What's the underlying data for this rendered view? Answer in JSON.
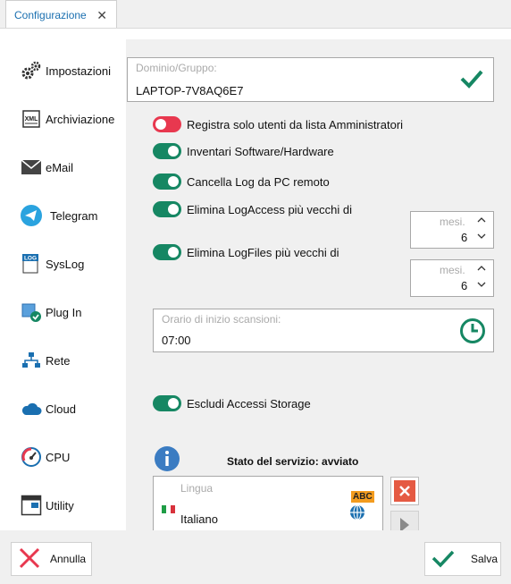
{
  "tab": {
    "title": "Configurazione",
    "close": "✕"
  },
  "sidebar": {
    "items": [
      {
        "label": "Impostazioni"
      },
      {
        "label": "Archiviazione"
      },
      {
        "label": "eMail"
      },
      {
        "label": "Telegram"
      },
      {
        "label": "SysLog"
      },
      {
        "label": "Plug In"
      },
      {
        "label": "Rete"
      },
      {
        "label": "Cloud"
      },
      {
        "label": "CPU"
      },
      {
        "label": "Utility"
      }
    ],
    "icon_xml_text": "XML",
    "icon_log_text": "LOG"
  },
  "domain": {
    "placeholder": "Dominio/Gruppo:",
    "value": "LAPTOP-7V8AQ6E7"
  },
  "toggles": {
    "registra": {
      "label": "Registra solo utenti da lista Amministratori",
      "on": false
    },
    "inventari": {
      "label": "Inventari Software/Hardware",
      "on": true
    },
    "cancella": {
      "label": "Cancella Log da PC remoto",
      "on": true
    },
    "elimina_access": {
      "label": "Elimina LogAccess più vecchi di",
      "on": true
    },
    "elimina_files": {
      "label": "Elimina LogFiles più vecchi di",
      "on": true
    },
    "escludi": {
      "label": "Escludi Accessi Storage",
      "on": true
    }
  },
  "spin_access": {
    "placeholder": "mesi.",
    "value": "6"
  },
  "spin_files": {
    "placeholder": "mesi.",
    "value": "6"
  },
  "schedule": {
    "placeholder": "Orario di inizio scansioni:",
    "value": "07:00"
  },
  "service": {
    "status": "Stato del servizio: avviato"
  },
  "language": {
    "placeholder": "Lingua",
    "value": "Italiano",
    "badge": "ABC"
  },
  "buttons": {
    "cancel": "Annulla",
    "save": "Salva"
  },
  "colors": {
    "accent": "#168763",
    "off": "#e8384f",
    "link": "#1a6fb0"
  }
}
